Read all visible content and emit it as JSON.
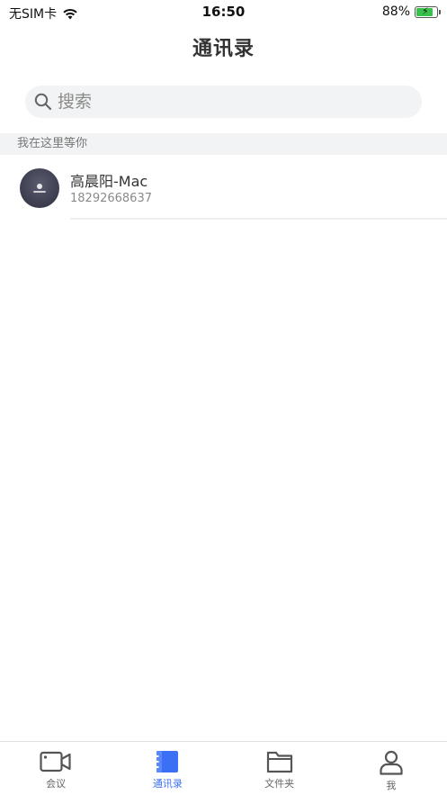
{
  "status_bar": {
    "carrier": "无SIM卡",
    "time": "16:50",
    "battery_percent": "88%",
    "battery_level": 0.88,
    "battery_color": "#38c14a"
  },
  "header": {
    "title": "通讯录"
  },
  "search": {
    "placeholder": "搜索",
    "icon": "search-icon"
  },
  "section": {
    "title": "我在这里等你"
  },
  "contacts": [
    {
      "name": "高晨阳-Mac",
      "phone": "18292668637",
      "avatar": "avatar"
    }
  ],
  "tab_bar": {
    "active_color": "#3b6ff5",
    "items": [
      {
        "label": "会议",
        "icon": "video-camera-icon",
        "active": false
      },
      {
        "label": "通讯录",
        "icon": "contacts-book-icon",
        "active": true
      },
      {
        "label": "文件夹",
        "icon": "folder-icon",
        "active": false
      },
      {
        "label": "我",
        "icon": "person-icon",
        "active": false
      }
    ]
  }
}
